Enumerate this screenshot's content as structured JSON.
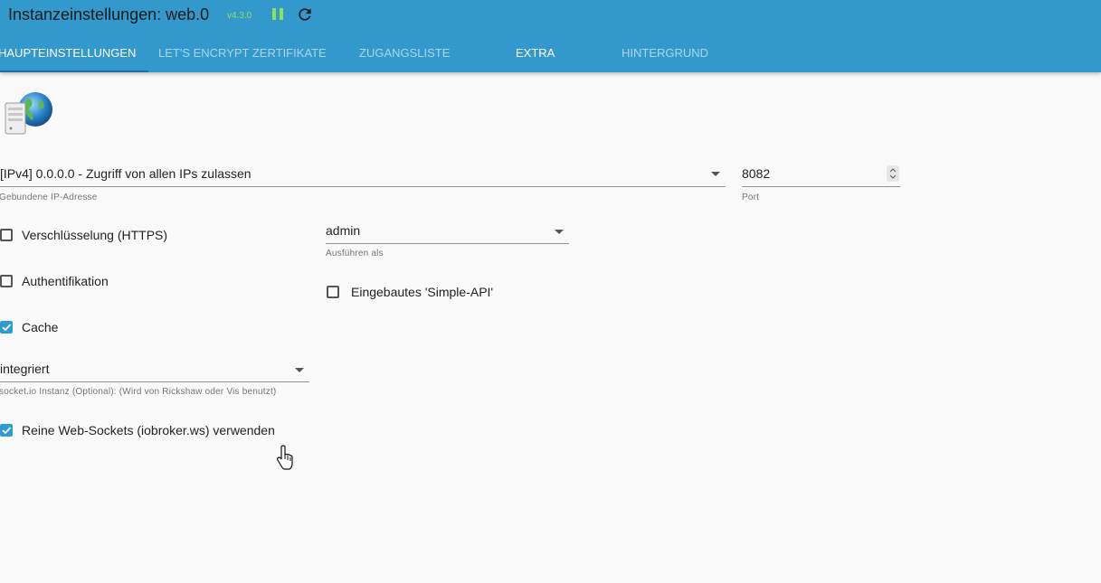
{
  "header": {
    "title": "Instanzeinstellungen: web.0",
    "version": "v4.3.0",
    "pause_icon": "pause-icon",
    "reload_icon": "reload-icon"
  },
  "tabs": [
    {
      "label": "HAUPTEINSTELLUNGEN",
      "active": true
    },
    {
      "label": "LET'S ENCRYPT ZERTIFIKATE",
      "active": false
    },
    {
      "label": "ZUGANGSLISTE",
      "active": false
    },
    {
      "label": "EXTRA",
      "active": false
    },
    {
      "label": "HINTERGRUND",
      "active": false
    }
  ],
  "logo_icon": "web-adapter-globe-server-icon",
  "form": {
    "ip": {
      "value": "[IPv4] 0.0.0.0 - Zugriff von allen IPs zulassen",
      "helper": "Gebundene IP-Adresse"
    },
    "port": {
      "value": "8082",
      "helper": "Port"
    },
    "https": {
      "label": "Verschlüsselung (HTTPS)",
      "checked": false
    },
    "run_as": {
      "value": "admin",
      "helper": "Ausführen als"
    },
    "auth": {
      "label": "Authentifikation",
      "checked": false
    },
    "simple_api": {
      "label": "Eingebautes 'Simple-API'",
      "checked": false
    },
    "cache": {
      "label": "Cache",
      "checked": true
    },
    "socketio": {
      "value": "integriert",
      "helper": "socket.io Instanz (Optional): (Wird von Rickshaw oder Vis benutzt)"
    },
    "websockets": {
      "label": "Reine Web-Sockets (iobroker.ws) verwenden",
      "checked": true
    }
  },
  "colors": {
    "header": "#3399cc",
    "checkbox_checked": "#2f9bd4",
    "version": "#8ee05a"
  }
}
